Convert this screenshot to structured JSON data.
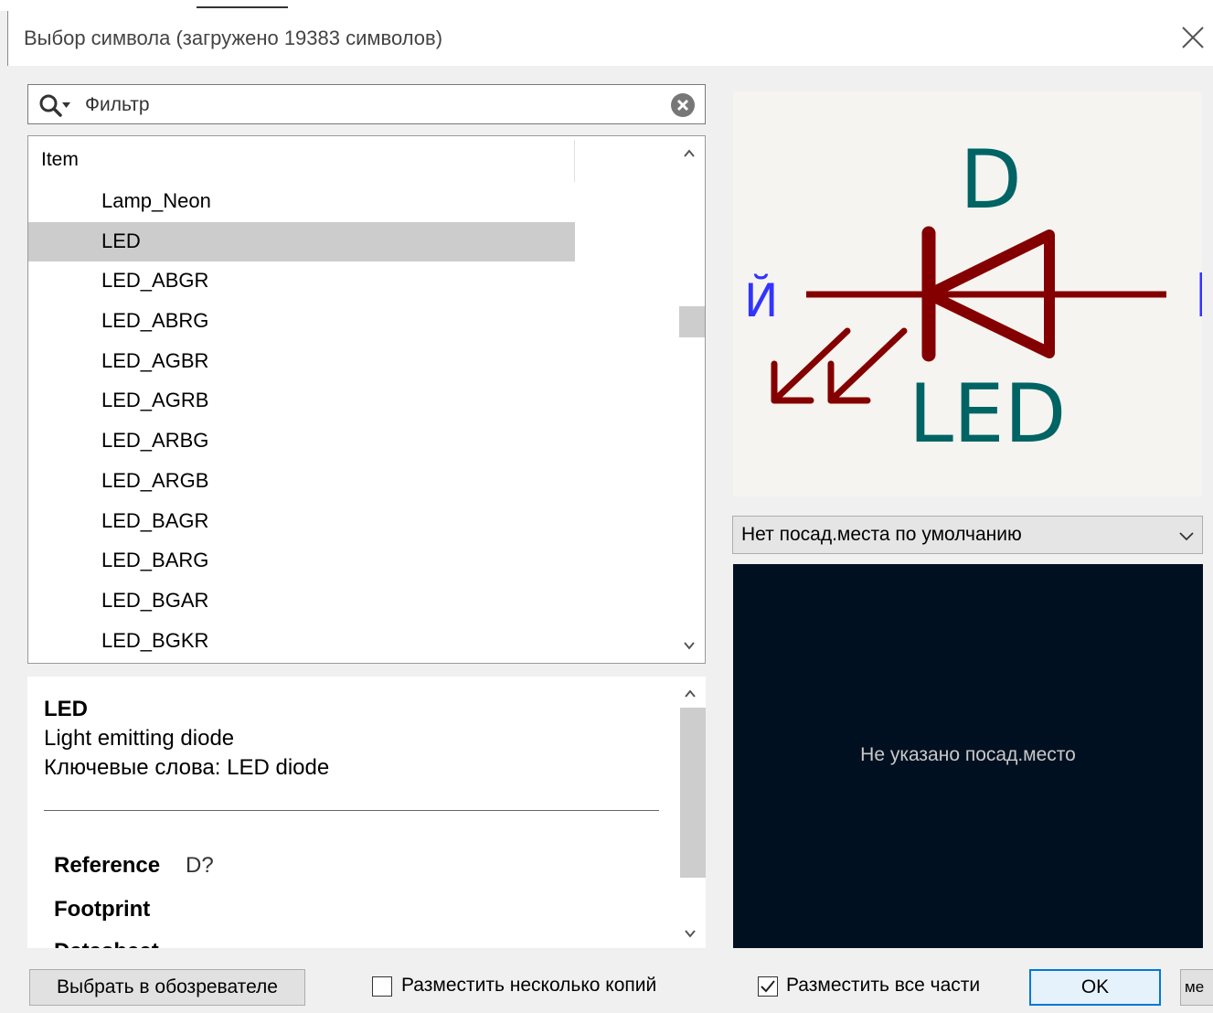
{
  "window": {
    "title": "Выбор символа (загружено 19383 символов)"
  },
  "filter": {
    "placeholder": "Фильтр"
  },
  "tree": {
    "column_header": "Item",
    "items": [
      "Lamp_Neon",
      "LED",
      "LED_ABGR",
      "LED_ABRG",
      "LED_AGBR",
      "LED_AGRB",
      "LED_ARBG",
      "LED_ARGB",
      "LED_BAGR",
      "LED_BARG",
      "LED_BGAR",
      "LED_BGKR"
    ],
    "selected": "LED"
  },
  "details": {
    "name": "LED",
    "description": "Light emitting diode",
    "keywords": "Ключевые слова: LED diode",
    "reference_label": "Reference",
    "reference_value": "D?",
    "footprint_label": "Footprint",
    "datasheet_label": "Datasheet"
  },
  "symbol_preview": {
    "reference": "D",
    "value": "LED",
    "pin_glyph": "Й",
    "colors": {
      "background": "#f5f4f0",
      "body": "#840000",
      "text": "#006464",
      "pin_text": "#3333ff"
    }
  },
  "footprint": {
    "selected": "Нет посад.места по умолчанию",
    "empty_message": "Не указано посад.место",
    "canvas_color": "#011021"
  },
  "buttons": {
    "browse": "Выбрать в обозревателе",
    "place_multiple": "Разместить несколько копий",
    "place_all_units": "Разместить все части",
    "ok": "OK",
    "cancel_partial": "ме"
  },
  "checkboxes": {
    "place_multiple_checked": false,
    "place_all_units_checked": true
  },
  "scrollbars": {
    "tree_position": 0.32,
    "details_position": 0.1
  }
}
